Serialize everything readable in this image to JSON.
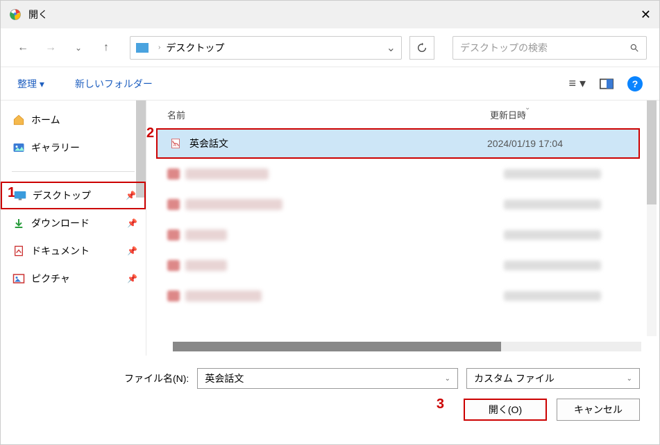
{
  "window": {
    "title": "開く"
  },
  "breadcrumb": {
    "location": "デスクトップ"
  },
  "search": {
    "placeholder": "デスクトップの検索"
  },
  "toolbar": {
    "organize": "整理 ▾",
    "new_folder": "新しいフォルダー"
  },
  "sidebar": {
    "items": [
      {
        "label": "ホーム",
        "icon": "home"
      },
      {
        "label": "ギャラリー",
        "icon": "gallery"
      },
      {
        "label": "デスクトップ",
        "icon": "desktop",
        "selected": true,
        "pin": true
      },
      {
        "label": "ダウンロード",
        "icon": "download",
        "pin": true
      },
      {
        "label": "ドキュメント",
        "icon": "document",
        "pin": true
      },
      {
        "label": "ピクチャ",
        "icon": "pictures",
        "pin": true
      }
    ]
  },
  "filelist": {
    "col_name": "名前",
    "col_date": "更新日時",
    "rows": [
      {
        "name": "英会話文",
        "date": "2024/01/19 17:04",
        "selected": true
      }
    ]
  },
  "footer": {
    "filename_label": "ファイル名(N):",
    "filename_value": "英会話文",
    "filetype_value": "カスタム ファイル",
    "open": "開く(O)",
    "cancel": "キャンセル"
  },
  "annotations": {
    "a1": "1",
    "a2": "2",
    "a3": "3"
  }
}
